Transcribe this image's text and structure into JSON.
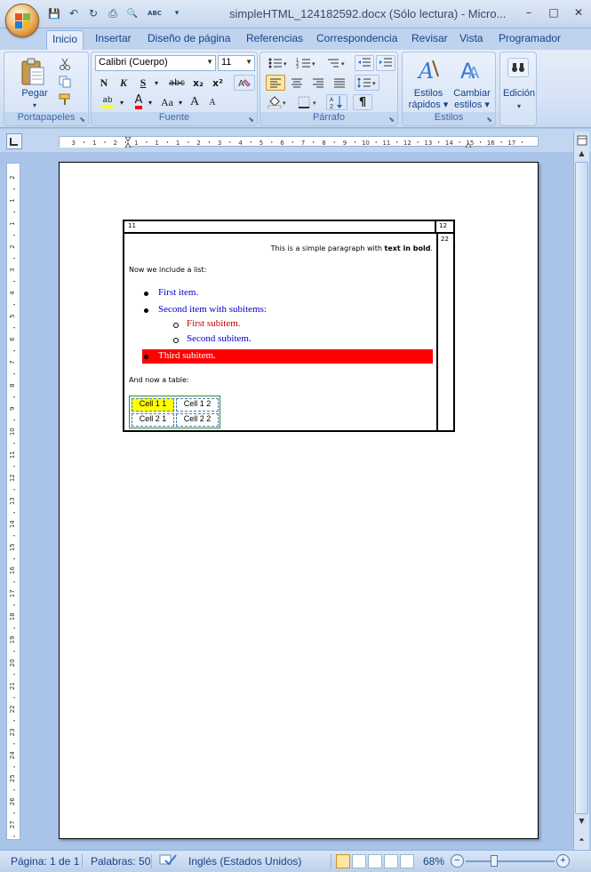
{
  "window": {
    "title": "simpleHTML_124182592.docx (Sólo lectura) - Micro...",
    "minimize": "–",
    "maximize": "□",
    "close": "✕"
  },
  "qat": {
    "save_icon": "💾",
    "undo_icon": "↶",
    "redo_icon": "↻",
    "print_icon": "⎙",
    "preview_icon": "🔍",
    "spell_icon": "ABC",
    "more": "▾"
  },
  "tabs": [
    "Inicio",
    "Insertar",
    "Diseño de página",
    "Referencias",
    "Correspondencia",
    "Revisar",
    "Vista",
    "Programador"
  ],
  "ribbon": {
    "clipboard": {
      "label": "Portapapeles",
      "paste": "Pegar"
    },
    "font": {
      "label": "Fuente",
      "font_name": "Calibri (Cuerpo)",
      "font_size": "11",
      "bold": "N",
      "italic": "K",
      "underline": "S",
      "strike": "abc",
      "subscript": "x₂",
      "superscript": "x²",
      "change_case": "Aa",
      "grow": "A",
      "shrink": "A",
      "highlight": "ab",
      "font_color": "A"
    },
    "paragraph": {
      "label": "Párrafo"
    },
    "styles": {
      "label": "Estilos",
      "quick_styles": "Estilos rápidos",
      "change_styles": "Cambiar estilos"
    },
    "editing": {
      "label": "Edición"
    }
  },
  "ruler": {
    "top_marks": [
      "3",
      "1",
      "2",
      "1",
      "1",
      "1",
      "2",
      "3",
      "4",
      "5",
      "6",
      "7",
      "8",
      "9",
      "10",
      "11",
      "12",
      "13",
      "14",
      "15",
      "16",
      "17"
    ],
    "left_marks": [
      "2",
      "1",
      "1",
      "2",
      "3",
      "4",
      "5",
      "6",
      "7",
      "8",
      "9",
      "10",
      "11",
      "12",
      "13",
      "14",
      "15",
      "16",
      "17",
      "18",
      "19",
      "20",
      "21",
      "22",
      "23",
      "24",
      "25",
      "26",
      "27"
    ]
  },
  "document": {
    "cell_11": "11",
    "cell_12": "12",
    "cell_22": "22",
    "para_1_normal": "This is a simple paragraph with ",
    "para_1_bold": "text in bold",
    "para_1_end": ".",
    "list_intro": "Now we include a list:",
    "list": [
      {
        "text": "First item.",
        "color": "#0000cc"
      },
      {
        "text": "Second item with subitems:",
        "color": "#0000cc"
      },
      {
        "text": "First subitem.",
        "color": "#cc0000"
      },
      {
        "text": "Second subitem.",
        "color": "#0000cc"
      },
      {
        "text": "Third subitem.",
        "color": "#ffffff",
        "background": "#ff0000"
      }
    ],
    "table_intro": "And now a table:",
    "inner_table": [
      [
        "Cell 1 1",
        "Cell 1 2"
      ],
      [
        "Cell 2 1",
        "Cell 2 2"
      ]
    ],
    "highlight_color": "#ffff00"
  },
  "statusbar": {
    "page": "Página: 1 de 1",
    "words": "Palabras: 50",
    "language": "Inglés (Estados Unidos)",
    "zoom": "68%",
    "zoom_minus": "−",
    "zoom_plus": "+"
  }
}
